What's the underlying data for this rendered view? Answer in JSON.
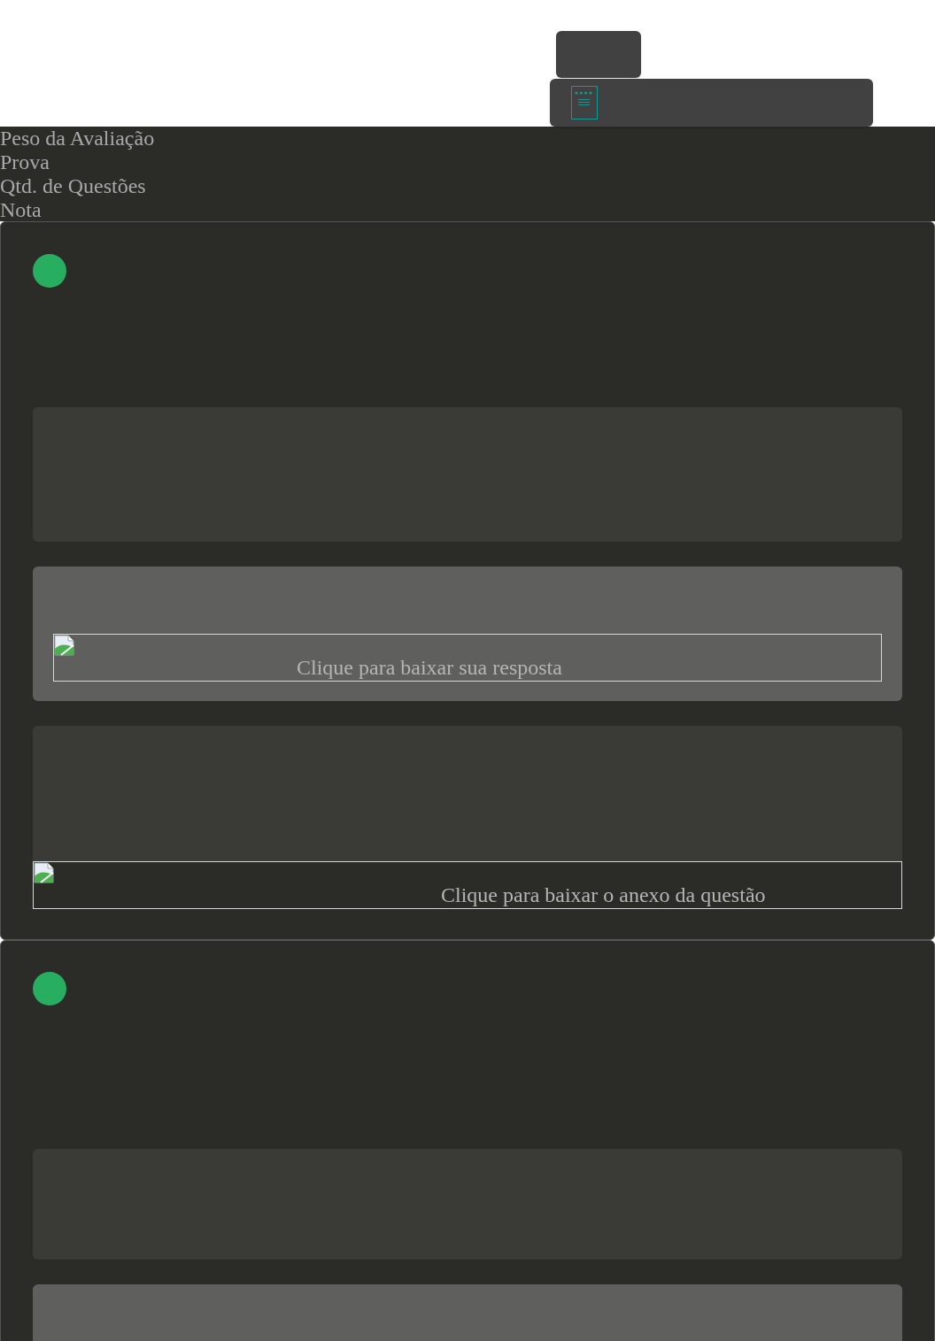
{
  "header_labels": [
    "Peso da Avaliação",
    "Prova",
    "Qtd. de Questões",
    "Nota"
  ],
  "questions": [
    {
      "kind": "full",
      "answer_link": "Clique para baixar sua resposta",
      "attachment_link": "Clique para baixar o anexo da questão"
    },
    {
      "kind": "cut"
    }
  ]
}
